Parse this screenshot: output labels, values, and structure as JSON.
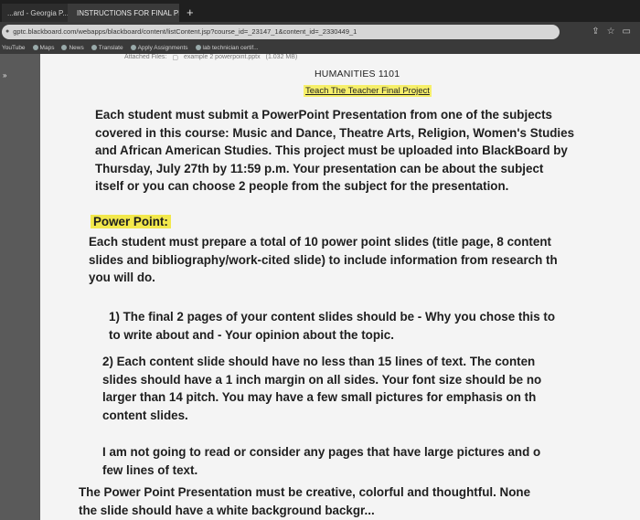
{
  "browser": {
    "tabs": [
      {
        "label": "...ard - Georgia P..."
      },
      {
        "label": "INSTRUCTIONS FOR FINAL PRO..."
      }
    ],
    "new_tab": "+",
    "url": "gptc.blackboard.com/webapps/blackboard/content/listContent.jsp?course_id=_23147_1&content_id=_2330449_1",
    "bookmarks": [
      "YouTube",
      "Maps",
      "News",
      "Translate",
      "Apply Assignments",
      "lab technician certif..."
    ]
  },
  "document": {
    "attachments_label": "Attached Files:",
    "file_name": "example 2 powerpoint.pptx",
    "file_size": "(1.032 MB)",
    "title": "HUMANITIES 1101",
    "subtitle": "Teach The Teacher Final Project",
    "paragraph1": [
      "Each student must submit a PowerPoint Presentation from one of the subjects",
      "covered in this course: Music and Dance, Theatre Arts, Religion, Women's Studies",
      "and African American Studies. This project must be uploaded into BlackBoard by",
      "Thursday, July 27th by 11:59 p.m.  Your presentation can be about the subject",
      "itself or you can choose 2 people from the subject for the presentation."
    ],
    "section_heading": "Power Point:",
    "paragraph2": [
      "Each student must prepare a total of 10 power point slides (title page, 8 content",
      "slides and bibliography/work-cited slide) to include information from research th",
      "you will do."
    ],
    "item1": [
      "1)  The final 2 pages of your content slides should be - Why you chose this to",
      "to write about and  - Your opinion about the topic."
    ],
    "item2": [
      "2)  Each content slide should have no less than 15 lines of text. The conten",
      "slides should have a 1 inch margin on all sides. Your font size should be no",
      "larger than 14 pitch.  You may have a few small pictures for emphasis on th",
      "content slides."
    ],
    "paragraph3": [
      "I am not going to read or consider any pages that have large pictures and o",
      "few lines of text."
    ],
    "paragraph4": [
      "The Power Point Presentation must be creative, colorful and thoughtful.  None",
      "the slide should have a white background  backgr..."
    ]
  }
}
